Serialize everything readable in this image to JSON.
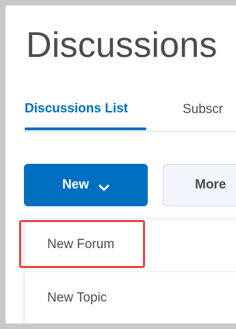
{
  "page": {
    "title": "Discussions"
  },
  "tabs": [
    {
      "label": "Discussions List",
      "active": true
    },
    {
      "label": "Subscr",
      "active": false
    }
  ],
  "toolbar": {
    "new_label": "New",
    "more_label": "More"
  },
  "dropdown": {
    "items": [
      {
        "label": "New Forum",
        "highlighted": true
      },
      {
        "label": "New Topic",
        "highlighted": false
      }
    ]
  },
  "colors": {
    "accent": "#006fbf",
    "highlight_box": "#e04545",
    "text": "#494c4e"
  },
  "icons": {
    "new_dropdown": "chevron-down-icon"
  }
}
